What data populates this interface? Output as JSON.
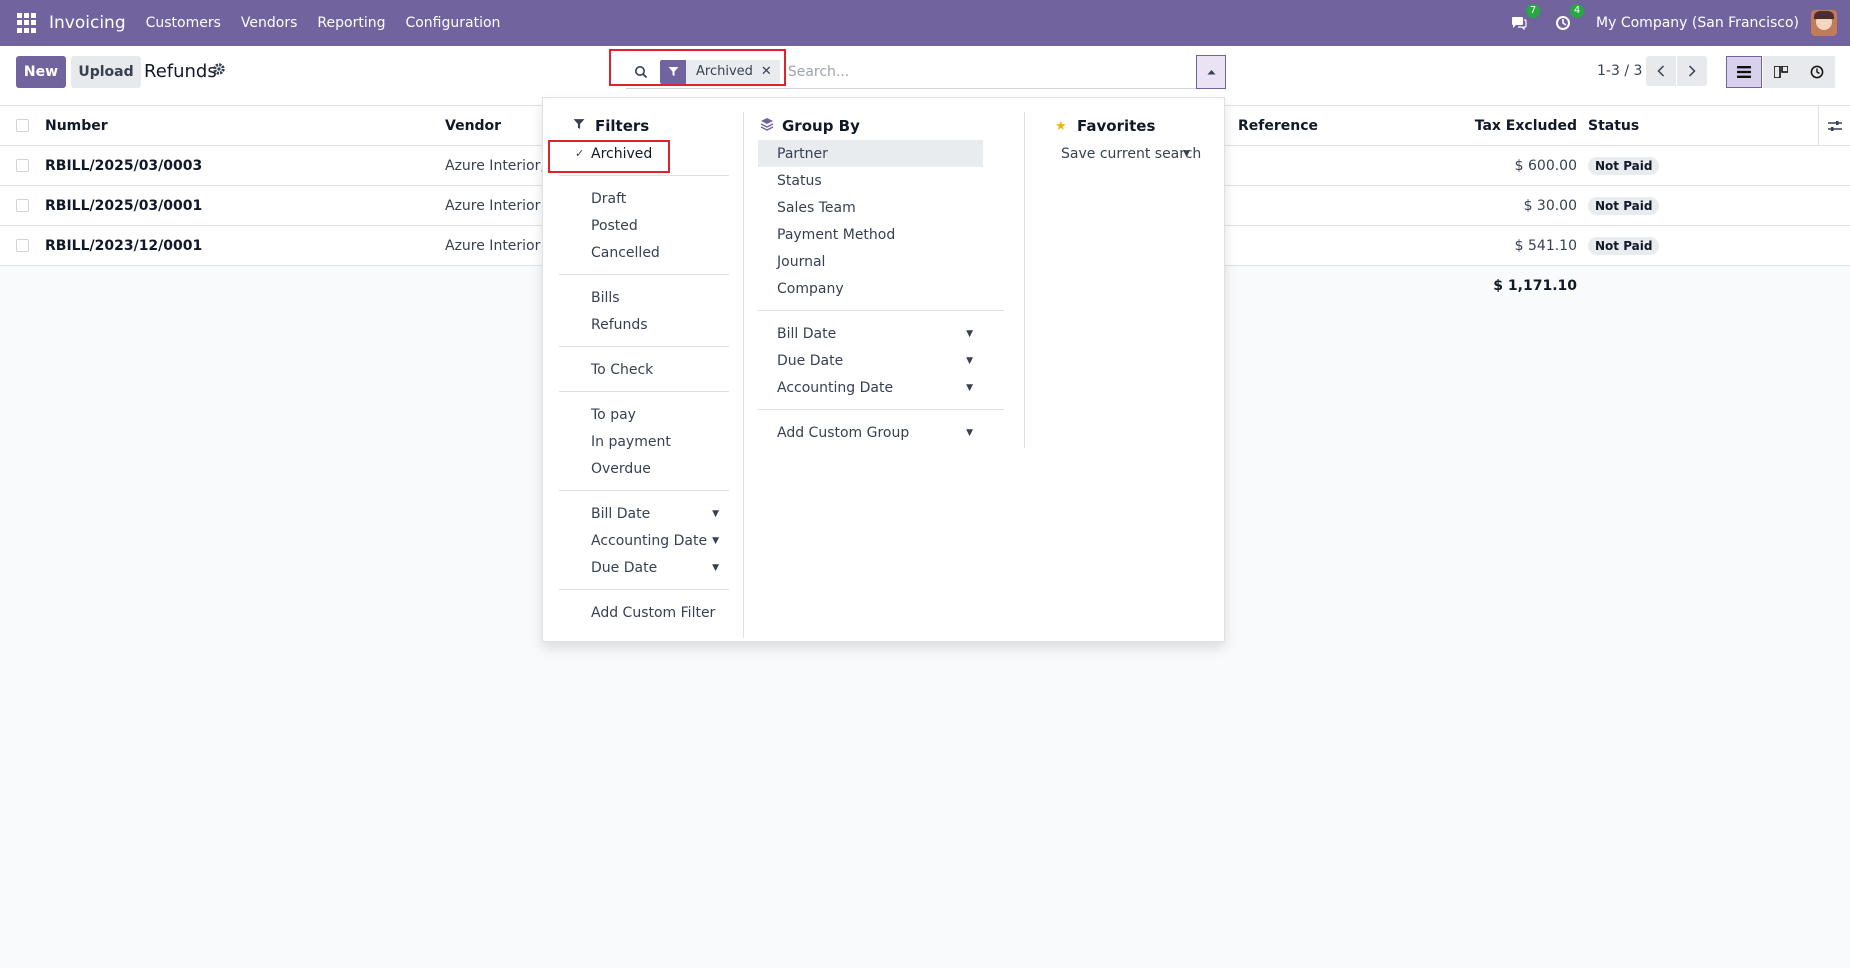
{
  "navbar": {
    "app_name": "Invoicing",
    "menu": [
      "Customers",
      "Vendors",
      "Reporting",
      "Configuration"
    ],
    "messages_badge": "7",
    "activities_badge": "4",
    "company": "My Company (San Francisco)"
  },
  "control": {
    "new_label": "New",
    "upload_label": "Upload",
    "title": "Refunds",
    "pager": "1-3 / 3"
  },
  "search": {
    "facet_label": "Archived",
    "placeholder": "Search..."
  },
  "table": {
    "headers": {
      "number": "Number",
      "vendor": "Vendor",
      "reference": "Reference",
      "tax_excluded": "Tax Excluded",
      "status": "Status"
    },
    "rows": [
      {
        "number": "RBILL/2025/03/0003",
        "vendor": "Azure Interior, M",
        "tax": "$ 600.00",
        "status": "Not Paid"
      },
      {
        "number": "RBILL/2025/03/0001",
        "vendor": "Azure Interior",
        "tax": "$ 30.00",
        "status": "Not Paid"
      },
      {
        "number": "RBILL/2023/12/0001",
        "vendor": "Azure Interior",
        "tax": "$ 541.10",
        "status": "Not Paid"
      }
    ],
    "total": "$ 1,171.10"
  },
  "filters": {
    "title": "Filters",
    "archived": "Archived",
    "state": [
      "Draft",
      "Posted",
      "Cancelled"
    ],
    "types": [
      "Bills",
      "Refunds"
    ],
    "check": [
      "To Check"
    ],
    "payment": [
      "To pay",
      "In payment",
      "Overdue"
    ],
    "dates": [
      "Bill Date",
      "Accounting Date",
      "Due Date"
    ],
    "custom": "Add Custom Filter"
  },
  "group_by": {
    "title": "Group By",
    "fields": [
      "Partner",
      "Status",
      "Sales Team",
      "Payment Method",
      "Journal",
      "Company"
    ],
    "dates": [
      "Bill Date",
      "Due Date",
      "Accounting Date"
    ],
    "custom": "Add Custom Group"
  },
  "favorites": {
    "title": "Favorites",
    "save": "Save current search"
  },
  "colors": {
    "brand": "#71639e",
    "highlight": "#e0232b",
    "badge": "#28a745"
  }
}
